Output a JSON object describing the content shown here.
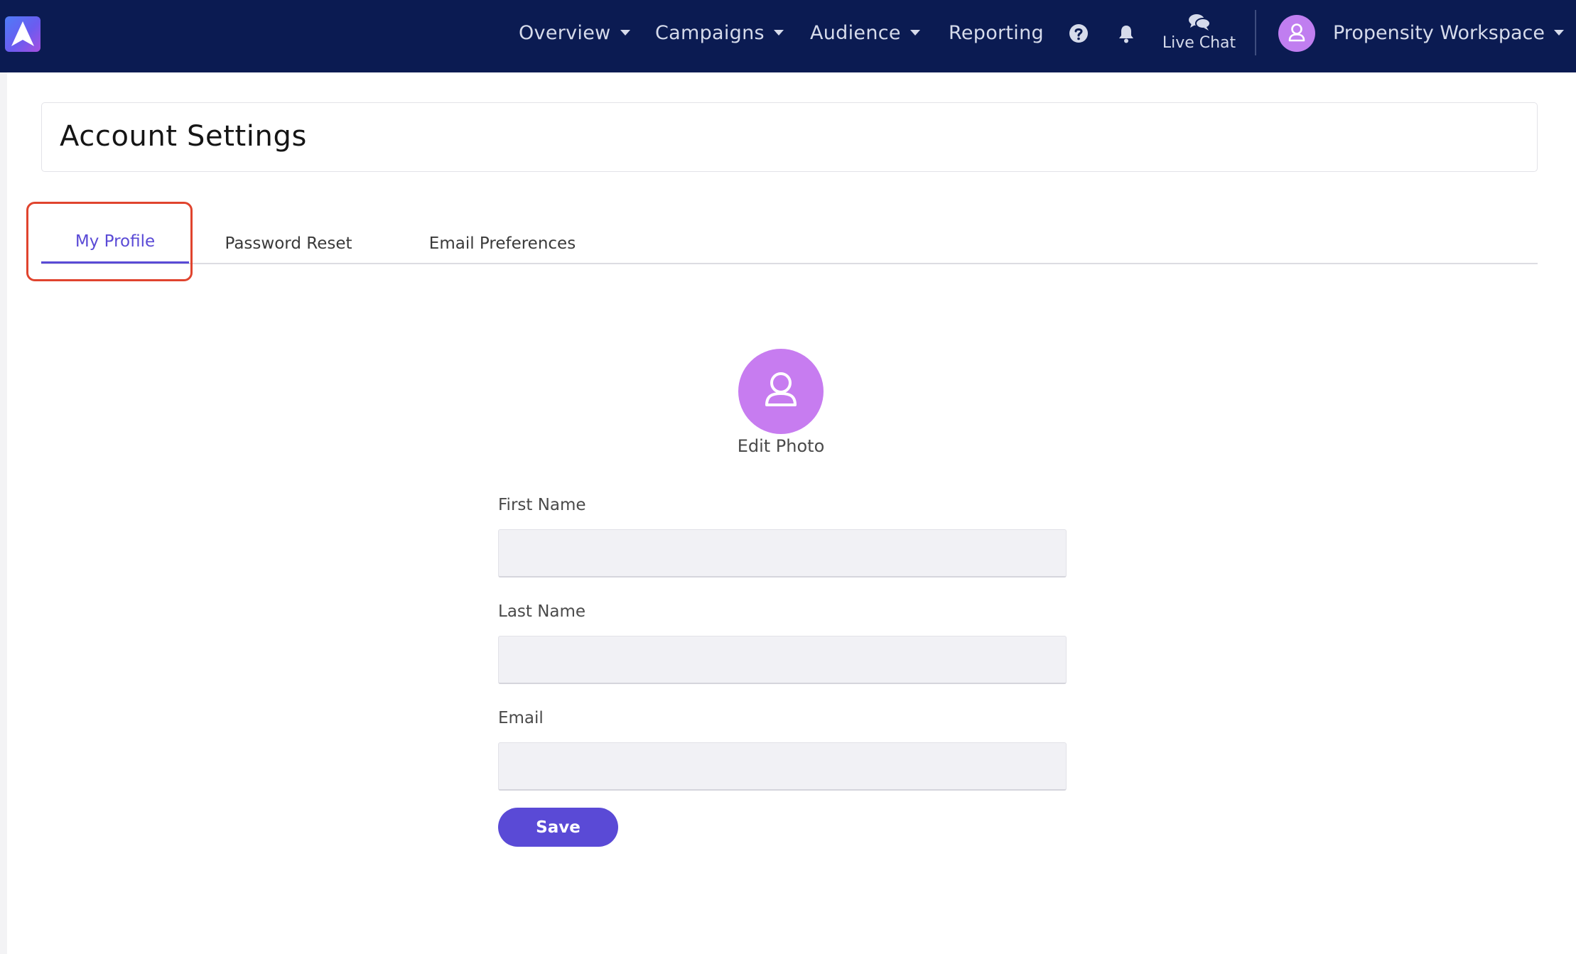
{
  "nav": {
    "items": [
      {
        "label": "Overview"
      },
      {
        "label": "Campaigns"
      },
      {
        "label": "Audience"
      },
      {
        "label": "Reporting"
      }
    ],
    "live_chat_label": "Live Chat",
    "workspace_label": "Propensity Workspace",
    "icons": [
      "logo-icon",
      "help-icon",
      "bell-icon",
      "chat-bubbles-icon",
      "user-icon"
    ]
  },
  "page": {
    "title": "Account Settings"
  },
  "tabs": [
    {
      "label": "My Profile",
      "active": true
    },
    {
      "label": "Password Reset",
      "active": false
    },
    {
      "label": "Email Preferences",
      "active": false
    }
  ],
  "profile": {
    "edit_photo_label": "Edit Photo",
    "fields": [
      {
        "label": "First Name",
        "value": "",
        "placeholder": ""
      },
      {
        "label": "Last Name",
        "value": "",
        "placeholder": ""
      },
      {
        "label": "Email",
        "value": "",
        "placeholder": ""
      }
    ],
    "save_label": "Save"
  },
  "colors": {
    "nav_background": "#0b1b52",
    "accent": "#5a4ad6",
    "avatar": "#c77cf0",
    "highlight": "#e0442e"
  }
}
